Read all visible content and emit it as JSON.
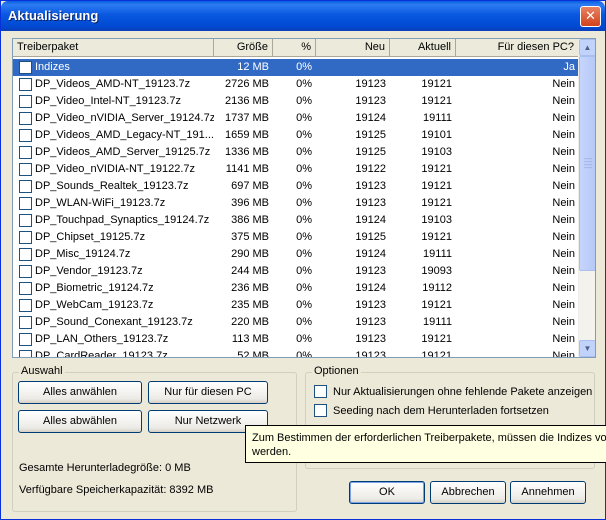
{
  "window": {
    "title": "Aktualisierung",
    "close_glyph": "✕"
  },
  "list": {
    "columns": [
      "Treiberpaket",
      "Größe",
      "%",
      "Neu",
      "Aktuell",
      "Für diesen PC?"
    ],
    "rows": [
      {
        "name": "Indizes",
        "size": "12 MB",
        "percent": "0%",
        "new": "",
        "current": "",
        "for_pc": "Ja",
        "selected": true
      },
      {
        "name": "DP_Videos_AMD-NT_19123.7z",
        "size": "2726 MB",
        "percent": "0%",
        "new": "19123",
        "current": "19121",
        "for_pc": "Nein"
      },
      {
        "name": "DP_Video_Intel-NT_19123.7z",
        "size": "2136 MB",
        "percent": "0%",
        "new": "19123",
        "current": "19121",
        "for_pc": "Nein"
      },
      {
        "name": "DP_Video_nVIDIA_Server_19124.7z",
        "size": "1737 MB",
        "percent": "0%",
        "new": "19124",
        "current": "19111",
        "for_pc": "Nein"
      },
      {
        "name": "DP_Videos_AMD_Legacy-NT_191...",
        "size": "1659 MB",
        "percent": "0%",
        "new": "19125",
        "current": "19101",
        "for_pc": "Nein"
      },
      {
        "name": "DP_Videos_AMD_Server_19125.7z",
        "size": "1336 MB",
        "percent": "0%",
        "new": "19125",
        "current": "19103",
        "for_pc": "Nein"
      },
      {
        "name": "DP_Video_nVIDIA-NT_19122.7z",
        "size": "1141 MB",
        "percent": "0%",
        "new": "19122",
        "current": "19121",
        "for_pc": "Nein"
      },
      {
        "name": "DP_Sounds_Realtek_19123.7z",
        "size": "697 MB",
        "percent": "0%",
        "new": "19123",
        "current": "19121",
        "for_pc": "Nein"
      },
      {
        "name": "DP_WLAN-WiFi_19123.7z",
        "size": "396 MB",
        "percent": "0%",
        "new": "19123",
        "current": "19121",
        "for_pc": "Nein"
      },
      {
        "name": "DP_Touchpad_Synaptics_19124.7z",
        "size": "386 MB",
        "percent": "0%",
        "new": "19124",
        "current": "19103",
        "for_pc": "Nein"
      },
      {
        "name": "DP_Chipset_19125.7z",
        "size": "375 MB",
        "percent": "0%",
        "new": "19125",
        "current": "19121",
        "for_pc": "Nein"
      },
      {
        "name": "DP_Misc_19124.7z",
        "size": "290 MB",
        "percent": "0%",
        "new": "19124",
        "current": "19111",
        "for_pc": "Nein"
      },
      {
        "name": "DP_Vendor_19123.7z",
        "size": "244 MB",
        "percent": "0%",
        "new": "19123",
        "current": "19093",
        "for_pc": "Nein"
      },
      {
        "name": "DP_Biometric_19124.7z",
        "size": "236 MB",
        "percent": "0%",
        "new": "19124",
        "current": "19112",
        "for_pc": "Nein"
      },
      {
        "name": "DP_WebCam_19123.7z",
        "size": "235 MB",
        "percent": "0%",
        "new": "19123",
        "current": "19121",
        "for_pc": "Nein"
      },
      {
        "name": "DP_Sound_Conexant_19123.7z",
        "size": "220 MB",
        "percent": "0%",
        "new": "19123",
        "current": "19111",
        "for_pc": "Nein"
      },
      {
        "name": "DP_LAN_Others_19123.7z",
        "size": "113 MB",
        "percent": "0%",
        "new": "19123",
        "current": "19121",
        "for_pc": "Nein"
      },
      {
        "name": "DP_CardReader_19123.7z",
        "size": "52 MB",
        "percent": "0%",
        "new": "19123",
        "current": "19121",
        "for_pc": "Nein"
      }
    ]
  },
  "selection": {
    "group_label": "Auswahl",
    "select_all": "Alles anwählen",
    "only_this_pc": "Nur für diesen PC",
    "deselect_all": "Alles abwählen",
    "only_network": "Nur Netzwerk",
    "total_download": "Gesamte Herunterladegröße: 0 MB",
    "free_space": "Verfügbare Speicherkapazität: 8392 MB"
  },
  "options": {
    "group_label": "Optionen",
    "only_updates": "Nur Aktualisierungen ohne fehlende Pakete anzeigen",
    "seeding": "Seeding nach dem Herunterladen fortsetzen"
  },
  "tooltip": {
    "line1": "Zum Bestimmen der erforderlichen Treiberpakete, müssen die Indizes vorab",
    "line2": "werden."
  },
  "buttons": {
    "ok": "OK",
    "cancel": "Abbrechen",
    "accept": "Annehmen"
  },
  "colors": {
    "title_bar": "#0a58e0",
    "selection": "#316ac5",
    "dialog_bg": "#ece9d8",
    "tooltip_bg": "#ffffe1"
  }
}
